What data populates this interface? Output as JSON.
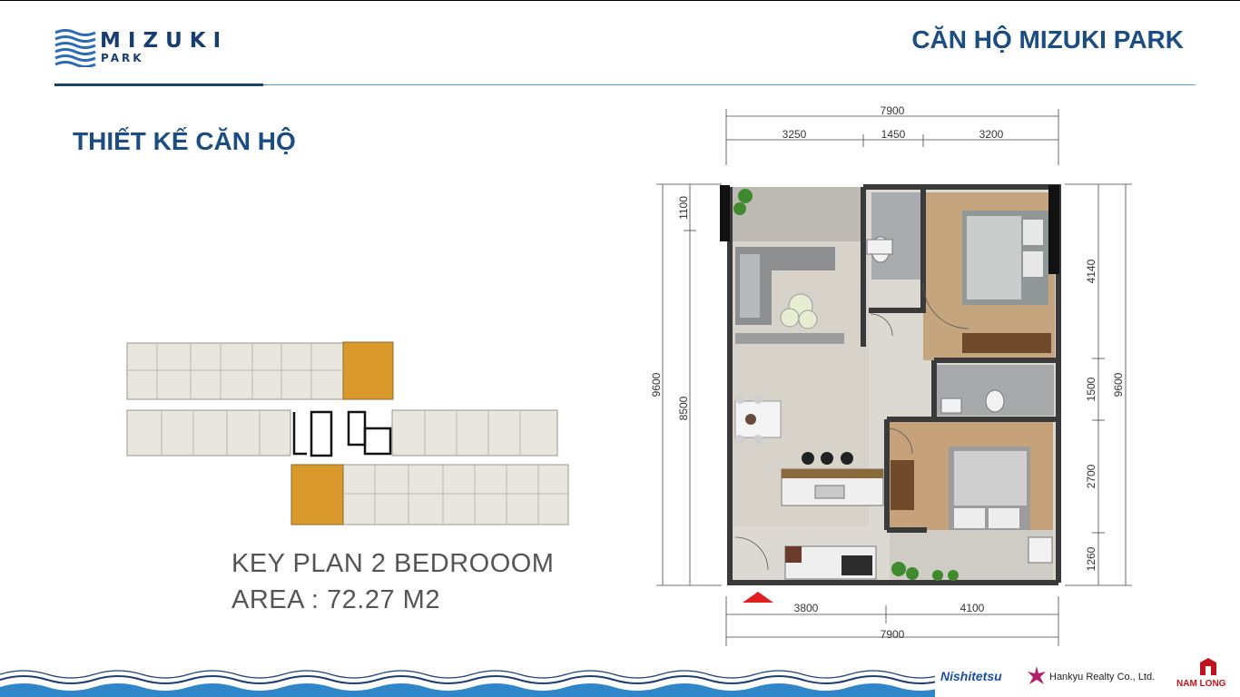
{
  "header": {
    "logo": {
      "word": "MIZUKI",
      "sub": "PARK"
    },
    "title": "CĂN HỘ MIZUKI PARK"
  },
  "section": {
    "title": "THIẾT KẾ CĂN HỘ"
  },
  "keyplan": {
    "line1": "KEY PLAN 2 BEDROOOM",
    "line2": "AREA  : 72.27 M2"
  },
  "floorplan": {
    "top_total": "7900",
    "top_segments": [
      "3250",
      "1450",
      "3200"
    ],
    "bottom_segments": [
      "3800",
      "4100"
    ],
    "bottom_total": "7900",
    "left_total": "9600",
    "left_segments": [
      "1100",
      "8500"
    ],
    "right_segments": [
      "4140",
      "1500",
      "2700",
      "1260"
    ],
    "right_total": "9600"
  },
  "partners": {
    "p1": "Nishitetsu",
    "p2": "Hankyu Realty Co., Ltd.",
    "p3": "NAM LONG"
  },
  "colors": {
    "brand": "#1c4d80",
    "accent_line": "#4f9ed9",
    "highlight_unit": "#d99a2b"
  }
}
